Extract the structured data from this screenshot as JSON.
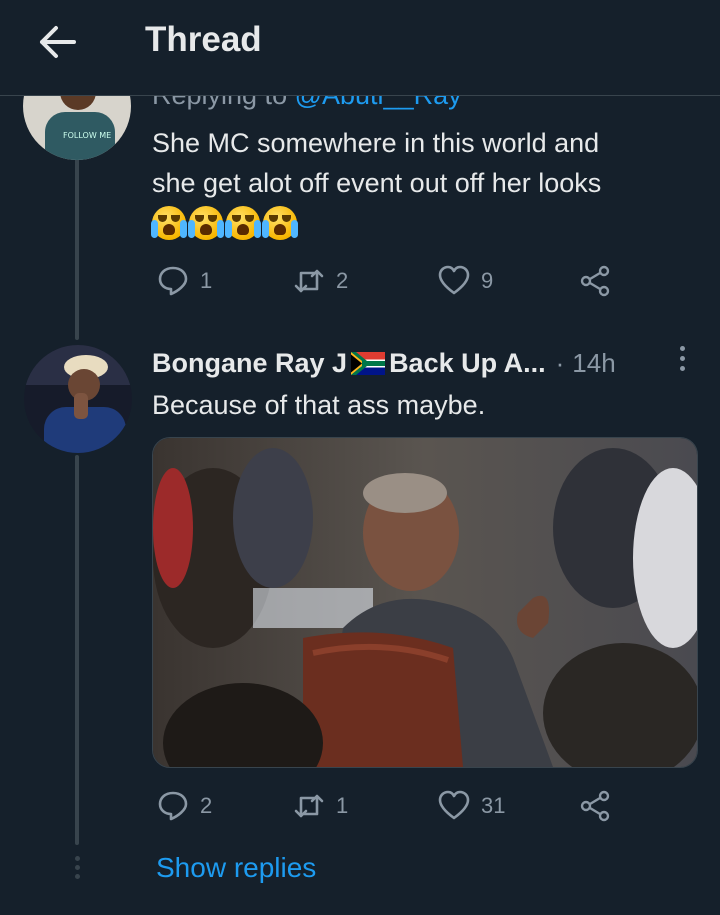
{
  "header": {
    "title": "Thread",
    "back_icon": "arrow-left-icon"
  },
  "tweet_1": {
    "replying_prefix": "Replying to",
    "replying_handle": "@Abuti__Ray",
    "text_line_1": "She MC somewhere in this world and",
    "text_line_2": "she get alot off event out off her looks",
    "emoji": [
      "loudly-crying-face",
      "loudly-crying-face",
      "loudly-crying-face",
      "loudly-crying-face"
    ],
    "actions": {
      "replies": "1",
      "retweets": "2",
      "likes": "9"
    }
  },
  "tweet_2": {
    "author": "Bongane Ray J",
    "author_suffix": "Back Up A...",
    "separator": "·",
    "time": "14h",
    "flag_icon": "south-africa-flag-icon",
    "text": "Because of that ass maybe.",
    "actions": {
      "replies": "2",
      "retweets": "1",
      "likes": "31"
    }
  },
  "show_replies": "Show replies",
  "colors": {
    "background": "#15202b",
    "text": "#e7e9ea",
    "secondary": "#8b98a5",
    "link": "#1d9bf0",
    "line": "#38444d"
  }
}
